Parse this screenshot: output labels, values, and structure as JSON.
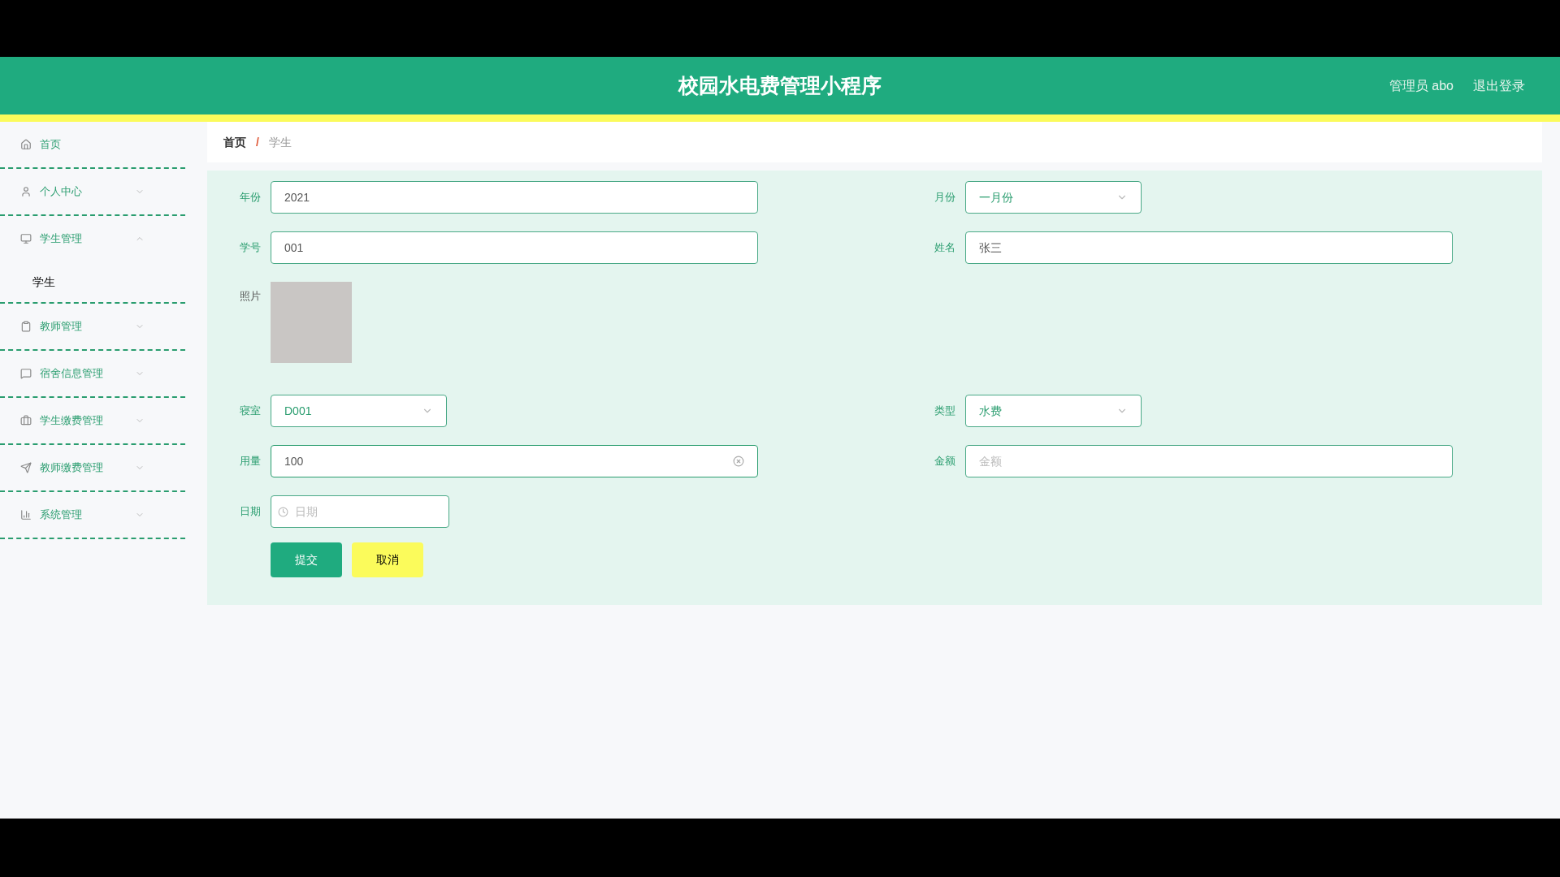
{
  "header": {
    "title": "校园水电费管理小程序",
    "user": "管理员 abo",
    "logout": "退出登录"
  },
  "sidebar": {
    "items": [
      {
        "label": "首页",
        "kind": "link"
      },
      {
        "label": "个人中心",
        "kind": "menu",
        "expanded": false
      },
      {
        "label": "学生管理",
        "kind": "menu",
        "expanded": true,
        "children": [
          {
            "label": "学生",
            "selected": true
          }
        ]
      },
      {
        "label": "教师管理",
        "kind": "menu",
        "expanded": false
      },
      {
        "label": "宿舍信息管理",
        "kind": "menu",
        "expanded": false
      },
      {
        "label": "学生缴费管理",
        "kind": "menu",
        "expanded": false
      },
      {
        "label": "教师缴费管理",
        "kind": "menu",
        "expanded": false
      },
      {
        "label": "系统管理",
        "kind": "menu",
        "expanded": false
      }
    ]
  },
  "breadcrumb": {
    "items": [
      "首页",
      "学生"
    ],
    "separator": "/"
  },
  "form": {
    "rows": [
      [
        {
          "label": "年份",
          "kind": "input",
          "value": "2021",
          "focused": false
        },
        {
          "label": "月份",
          "kind": "select",
          "value": "一月份"
        }
      ],
      [
        {
          "label": "学号",
          "kind": "input",
          "value": "001",
          "focused": false
        },
        {
          "label": "姓名",
          "kind": "input",
          "value": "张三",
          "focused": false
        }
      ],
      [
        {
          "label": "照片",
          "kind": "image"
        }
      ],
      [
        {
          "label": "寝室",
          "kind": "select",
          "value": "D001"
        },
        {
          "label": "类型",
          "kind": "select",
          "value": "水费"
        }
      ],
      [
        {
          "label": "用量",
          "kind": "input",
          "value": "100",
          "focused": true
        },
        {
          "label": "金额",
          "kind": "input",
          "placeholder": "金额",
          "focused": false
        }
      ],
      [
        {
          "label": "日期",
          "kind": "date",
          "placeholder": "日期"
        }
      ]
    ],
    "buttons": [
      {
        "label": "提交",
        "kind": "primary"
      },
      {
        "label": "取消",
        "kind": "secondary"
      }
    ]
  }
}
